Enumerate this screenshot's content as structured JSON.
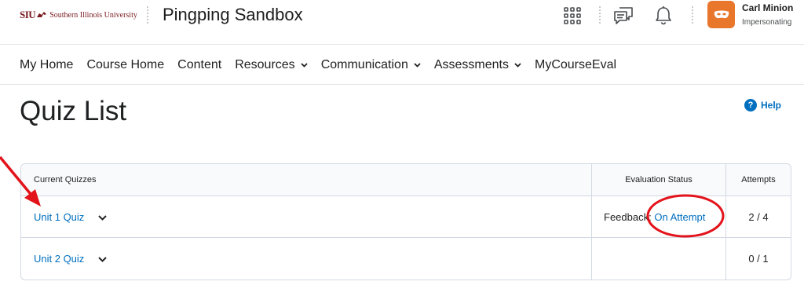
{
  "header": {
    "logo_siu": "SIU",
    "logo_name": "Southern Illinois University",
    "course_title": "Pingping Sandbox",
    "user_name": "Carl Minion",
    "user_role": "Impersonating",
    "icons": [
      "apps-grid-icon",
      "chat-bubbles-icon",
      "bell-icon"
    ],
    "avatar_color": "#e8762b"
  },
  "nav": {
    "items": [
      {
        "label": "My Home",
        "has_menu": false
      },
      {
        "label": "Course Home",
        "has_menu": false
      },
      {
        "label": "Content",
        "has_menu": false
      },
      {
        "label": "Resources",
        "has_menu": true
      },
      {
        "label": "Communication",
        "has_menu": true
      },
      {
        "label": "Assessments",
        "has_menu": true
      },
      {
        "label": "MyCourseEval",
        "has_menu": false
      }
    ]
  },
  "page": {
    "title": "Quiz List",
    "help_label": "Help"
  },
  "table": {
    "headers": [
      "Current Quizzes",
      "Evaluation Status",
      "Attempts"
    ],
    "rows": [
      {
        "name": "Unit 1 Quiz",
        "eval_label": "Feedback: ",
        "eval_link": "On Attempt",
        "attempts": "2 / 4"
      },
      {
        "name": "Unit 2 Quiz",
        "eval_label": "",
        "eval_link": "",
        "attempts": "0 / 1"
      }
    ]
  },
  "colors": {
    "link": "#006fbf",
    "brand": "#7a1a1f",
    "annotation": "#e3131b"
  }
}
